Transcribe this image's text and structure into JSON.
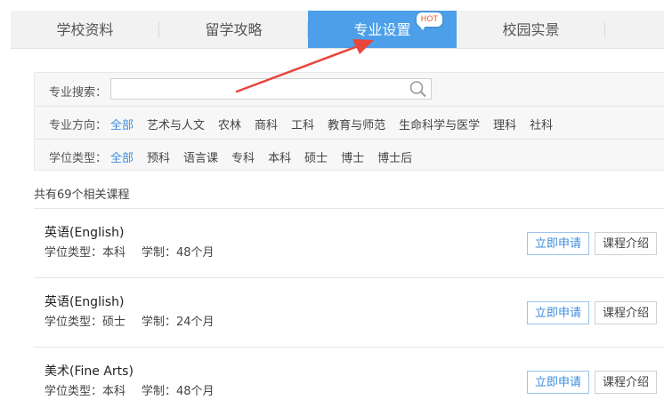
{
  "tabs": [
    {
      "label": "学校资料"
    },
    {
      "label": "留学攻略"
    },
    {
      "label": "专业设置",
      "badge": "HOT"
    },
    {
      "label": "校园实景"
    }
  ],
  "search": {
    "label": "专业搜索：",
    "value": ""
  },
  "direction": {
    "label": "专业方向：",
    "options": [
      "全部",
      "艺术与人文",
      "农林",
      "商科",
      "工科",
      "教育与师范",
      "生命科学与医学",
      "理科",
      "社科"
    ]
  },
  "degree": {
    "label": "学位类型：",
    "options": [
      "全部",
      "预科",
      "语言课",
      "专科",
      "本科",
      "硕士",
      "博士",
      "博士后"
    ]
  },
  "result_count": "共有69个相关课程",
  "courses": [
    {
      "name": "英语(English)",
      "degree": "学位类型：本科",
      "duration": "学制：48个月"
    },
    {
      "name": "英语(English)",
      "degree": "学位类型：硕士",
      "duration": "学制：24个月"
    },
    {
      "name": "美术(Fine Arts)",
      "degree": "学位类型：本科",
      "duration": "学制：48个月"
    }
  ],
  "buttons": {
    "apply": "立即申请",
    "intro": "课程介绍"
  },
  "colors": {
    "accent": "#4c9fe8",
    "link": "#3d8ddf",
    "hot": "#f05a28",
    "arrow": "#e8453c"
  }
}
